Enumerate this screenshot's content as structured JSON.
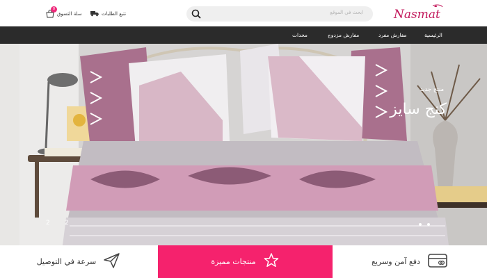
{
  "header": {
    "brand_name": "Nasmat",
    "search_placeholder": "ابحث في الموقع",
    "track_orders_label": "تتبع الطلبات",
    "cart_label": "سلة التسوق",
    "cart_count": "0"
  },
  "nav": {
    "items": [
      {
        "label": "الرئيسية"
      },
      {
        "label": "مفارش مفرد"
      },
      {
        "label": "مفارش مزدوج"
      },
      {
        "label": "مخدات"
      }
    ]
  },
  "hero": {
    "subtitle": "منتج جديد",
    "title": "كنج سايز",
    "slides": [
      "1",
      "2"
    ],
    "dots": 2
  },
  "features": [
    {
      "label": "دفع آمن وسريع",
      "icon": "credit-card-icon"
    },
    {
      "label": "منتجات مميزة",
      "icon": "star-icon"
    },
    {
      "label": "سرعة في التوصيل",
      "icon": "paper-plane-icon"
    }
  ],
  "colors": {
    "accent": "#f5226d",
    "badge": "#ee2a7b",
    "nav_bg": "#2b2b2b",
    "logo": "#c2185b"
  }
}
